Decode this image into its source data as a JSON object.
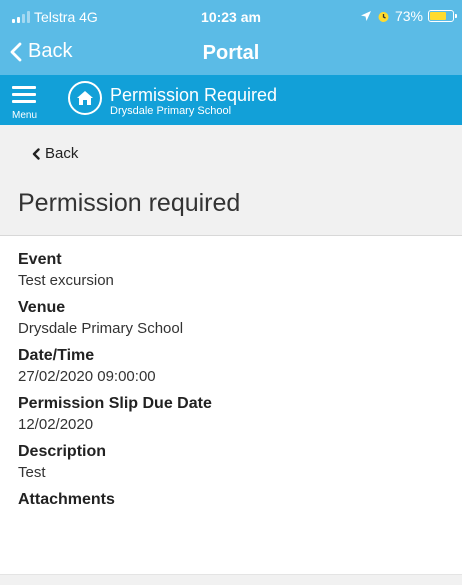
{
  "status_bar": {
    "carrier": "Telstra 4G",
    "time": "10:23 am",
    "battery_percent": "73%",
    "battery_level": 0.73
  },
  "nav": {
    "back_label": "Back",
    "title": "Portal"
  },
  "header": {
    "menu_label": "Menu",
    "title": "Permission Required",
    "subtitle": "Drysdale Primary School"
  },
  "page": {
    "back_label": "Back",
    "title": "Permission required"
  },
  "fields": [
    {
      "label": "Event",
      "value": "Test excursion"
    },
    {
      "label": "Venue",
      "value": "Drysdale Primary School"
    },
    {
      "label": "Date/Time",
      "value": "27/02/2020 09:00:00"
    },
    {
      "label": "Permission Slip Due Date",
      "value": "12/02/2020"
    },
    {
      "label": "Description",
      "value": "Test"
    },
    {
      "label": "Attachments",
      "value": ""
    }
  ],
  "colors": {
    "nav_bar": "#5bbbe6",
    "header_bar": "#12a0d8",
    "battery": "#ffdb2e"
  },
  "icons": [
    "signal-icon",
    "location-arrow-icon",
    "alarm-icon",
    "battery-icon",
    "chevron-left-icon",
    "menu-icon",
    "home-icon"
  ]
}
